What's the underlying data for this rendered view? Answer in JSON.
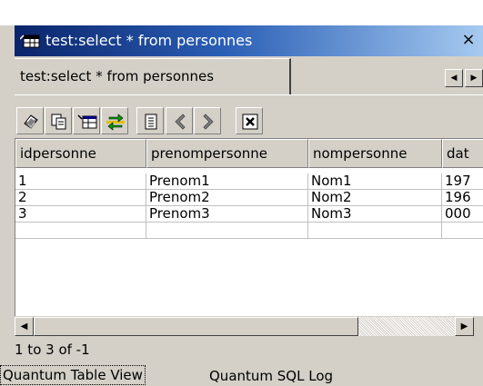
{
  "view": {
    "title": "test:select * from personnes",
    "close_symbol": "×"
  },
  "tabs": {
    "active_label": "test:select * from personnes",
    "scroll_left": "◀",
    "scroll_right": "▶"
  },
  "toolbar": {
    "buttons": [
      {
        "icon": "refresh-icon"
      },
      {
        "icon": "copy-icon"
      },
      {
        "icon": "insert-row-icon"
      },
      {
        "icon": "export-icon"
      },
      {
        "icon": "document-icon"
      },
      {
        "icon": "previous-icon"
      },
      {
        "icon": "next-icon"
      },
      {
        "icon": "close-icon"
      }
    ]
  },
  "grid": {
    "columns": [
      "idpersonne",
      "prenompersonne",
      "nompersonne",
      "dat"
    ],
    "rows": [
      [
        "1",
        "Prenom1",
        "Nom1",
        "197"
      ],
      [
        "2",
        "Prenom2",
        "Nom2",
        "196"
      ],
      [
        "3",
        "Prenom3",
        "Nom3",
        "000"
      ]
    ]
  },
  "hscroll": {
    "left_arrow": "◀",
    "right_arrow": "▶"
  },
  "status": {
    "text": "1 to 3 of -1"
  },
  "bottom_tabs": {
    "table_view": "Quantum Table View",
    "sql_log": "Quantum SQL Log"
  }
}
